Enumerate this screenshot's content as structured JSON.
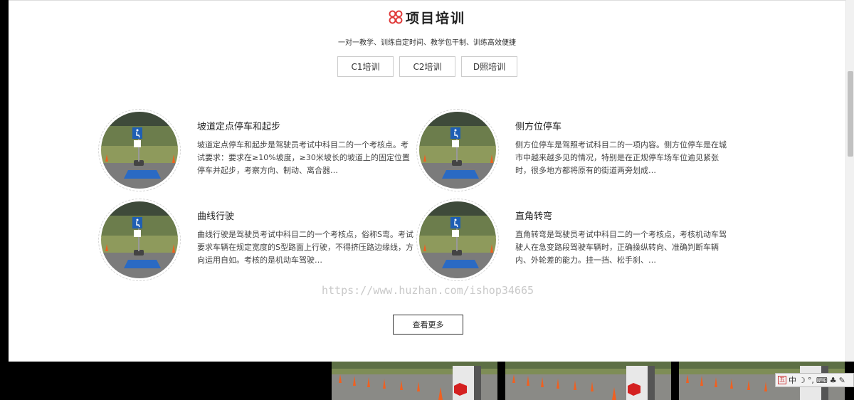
{
  "section": {
    "title": "项目培训",
    "subtitle": "一对一教学、训练自定时间、教学包干制、训练高效便捷"
  },
  "tabs": [
    {
      "label": "C1培训"
    },
    {
      "label": "C2培训"
    },
    {
      "label": "D照培训"
    }
  ],
  "cards": [
    {
      "title": "坡道定点停车和起步",
      "desc": "坡道定点停车和起步是驾驶员考试中科目二的一个考核点。考试要求：要求在≥10%坡度，≥30米坡长的坡道上的固定位置停车并起步，考察方向、制动、离合器…"
    },
    {
      "title": "侧方位停车",
      "desc": "侧方位停车是驾照考试科目二的一项内容。侧方位停车是在城市中越来越多见的情况，特别是在正规停车场车位逾见紧张时，很多地方都将原有的街道两旁划成…"
    },
    {
      "title": "曲线行驶",
      "desc": "曲线行驶是驾驶员考试中科目二的一个考核点，俗称S弯。考试要求车辆在规定宽度的S型路面上行驶，不得挤压路边缘线，方向运用自如。考核的是机动车驾驶…"
    },
    {
      "title": "直角转弯",
      "desc": "直角转弯是驾驶员考试中科目二的一个考核点，考核机动车驾驶人在急变路段驾驶车辆时，正确操纵转向、准确判断车辆内、外轮差的能力。挂一挡、松手刹、…"
    }
  ],
  "watermark": "https://www.huzhan.com/ishop34665",
  "more_button": "查看更多",
  "ime": {
    "lang": "中",
    "icons": [
      "moon-icon",
      "punctuation-icon",
      "keyboard-icon",
      "settings-icon",
      "wrench-icon"
    ]
  },
  "colors": {
    "accent": "#e03a3a",
    "sign_blue": "#1f5fb4"
  }
}
